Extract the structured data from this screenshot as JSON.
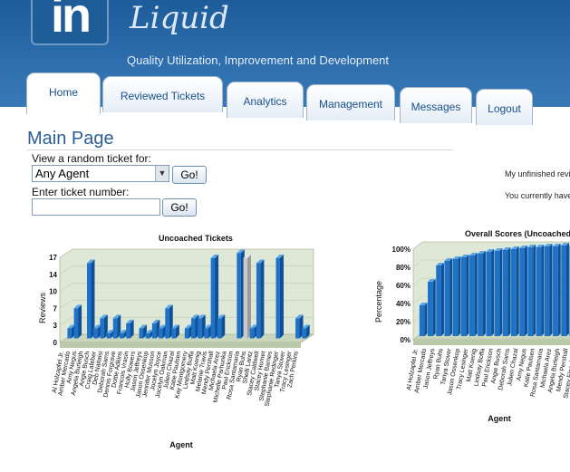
{
  "header": {
    "logo_text": "in",
    "app_name": "Liquid",
    "tagline": "Quality Utilization, Improvement and Development"
  },
  "tabs": [
    {
      "label": "Home",
      "active": true
    },
    {
      "label": "Reviewed Tickets",
      "active": false
    },
    {
      "label": "Analytics",
      "active": false
    },
    {
      "label": "Management",
      "active": false
    },
    {
      "label": "Messages",
      "active": false
    },
    {
      "label": "Logout",
      "active": false
    }
  ],
  "main": {
    "title": "Main Page",
    "random_ticket_label": "View a random ticket for:",
    "agent_select_value": "Any Agent",
    "go_label": "Go!",
    "ticket_number_label": "Enter ticket number:",
    "ticket_number_value": "",
    "go2_label": "Go!",
    "unfinished_text": "My unfinished revie",
    "currently_text": "You currently have"
  },
  "chart_data": [
    {
      "type": "bar",
      "title": "Uncoached Tickets",
      "xlabel": "Agent",
      "ylabel": "Reviews",
      "ylim": [
        0,
        17
      ],
      "yticks": [
        "0",
        "3",
        "7",
        "10",
        "14",
        "17"
      ],
      "categories": [
        "Al Holzapfel Jr.",
        "Amber Mercado",
        "Amy Negus",
        "Angela Burleigh",
        "Angie Busch",
        "Craig Lafeber",
        "Deb Naitaisi",
        "Deborah Sams",
        "Dennis Forgrave",
        "Dottie Adkins",
        "Francois Vrasin",
        "Holly Bowers",
        "Jason Jeffreys",
        "Jason Ossenkop",
        "Jennifer Musson",
        "Jocelyn Joyce",
        "Jocelyn Oakman",
        "Julien Chazal",
        "Katie Paulsen",
        "Kay Montgomery",
        "Lindsay Boffa",
        "Matt Koenig",
        "Melanie Travis",
        "Mendy Pershall",
        "Michaela Arez",
        "Michelle Parhunka",
        "Paul Erickson",
        "Rosa Santamaria",
        "Ryan Buhs",
        "Shelli Lantz",
        "Stacey Caldwell",
        "Stacey Hornet",
        "Stephanie Barnes",
        "Stephanie Redinger",
        "Tanya Stover",
        "Tracy Lesinger",
        "Zach Perkins"
      ],
      "values": [
        2,
        6,
        0,
        15,
        2,
        4,
        1,
        4,
        1,
        3,
        0,
        2,
        1,
        3,
        2,
        6,
        2,
        0,
        2,
        4,
        4,
        2,
        16,
        4,
        0,
        0,
        17,
        16,
        2,
        15,
        0,
        0,
        16,
        0,
        0,
        4,
        2
      ]
    },
    {
      "type": "bar",
      "title": "Overall Scores (Uncoached)",
      "xlabel": "Agent",
      "ylabel": "Percentage",
      "ylim": [
        0,
        100
      ],
      "yticks": [
        "0%",
        "20%",
        "40%",
        "60%",
        "80%",
        "100%"
      ],
      "categories": [
        "Al Holzapfel Jr.",
        "Amber Mercado",
        "Jason Jeffreys",
        "Ryan Buhs",
        "Tanya Stover",
        "Jason Ossenkop",
        "Tracy Lesinger",
        "Matt Koenig",
        "Lindsay Boffa",
        "Paul Erickson",
        "Angie Busch",
        "Deborah Sams",
        "Julien Chazal",
        "Amy Negus",
        "Katie Paulsen",
        "Rosa Santamaria",
        "Michaela Arez",
        "Angela Burleigh",
        "Mendy Pershall",
        "Stacey Finochiaro"
      ],
      "values": [
        34,
        60,
        78,
        83,
        85,
        87,
        89,
        91,
        93,
        94,
        95,
        96,
        97,
        98,
        98,
        99,
        99,
        100,
        100,
        100
      ]
    }
  ]
}
